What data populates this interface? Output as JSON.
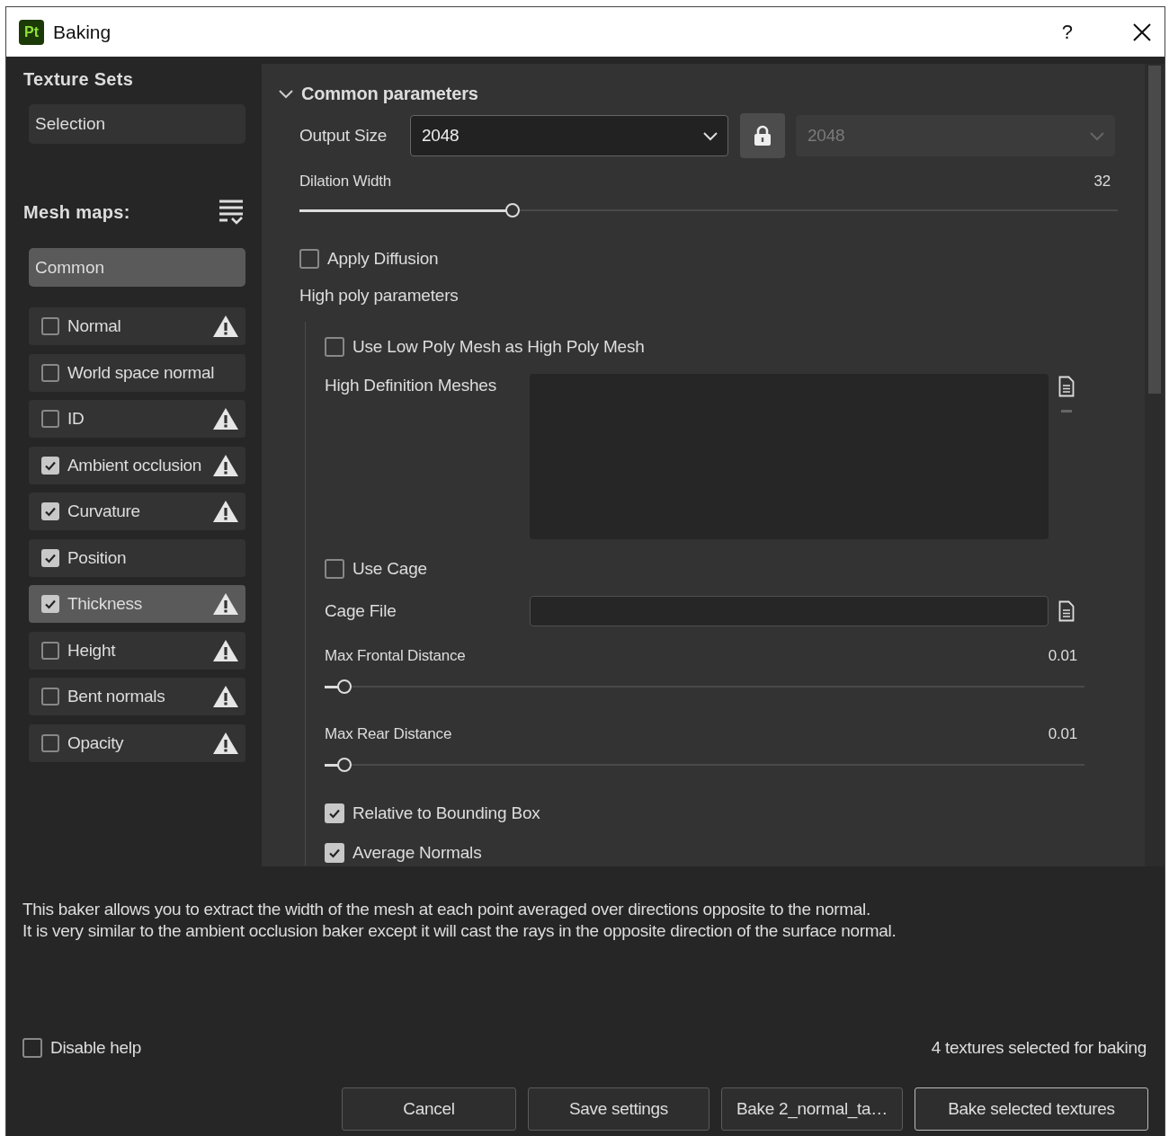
{
  "window": {
    "app_badge": "Pt",
    "title": "Baking",
    "help_button": "?"
  },
  "texture_sets": {
    "title": "Texture Sets",
    "items": [
      {
        "label": "Selection"
      }
    ]
  },
  "mesh_maps": {
    "title": "Mesh maps:",
    "common": {
      "label": "Common",
      "selected": true
    },
    "items": [
      {
        "label": "Normal",
        "checked": false,
        "selected": false,
        "warning": true
      },
      {
        "label": "World space normal",
        "checked": false,
        "selected": false,
        "warning": false
      },
      {
        "label": "ID",
        "checked": false,
        "selected": false,
        "warning": true
      },
      {
        "label": "Ambient occlusion",
        "checked": true,
        "selected": false,
        "warning": true
      },
      {
        "label": "Curvature",
        "checked": true,
        "selected": false,
        "warning": true
      },
      {
        "label": "Position",
        "checked": true,
        "selected": false,
        "warning": false
      },
      {
        "label": "Thickness",
        "checked": true,
        "selected": true,
        "warning": true
      },
      {
        "label": "Height",
        "checked": false,
        "selected": false,
        "warning": true
      },
      {
        "label": "Bent normals",
        "checked": false,
        "selected": false,
        "warning": true
      },
      {
        "label": "Opacity",
        "checked": false,
        "selected": false,
        "warning": true
      }
    ]
  },
  "common_parameters": {
    "title": "Common parameters",
    "expanded": true,
    "output_size": {
      "label": "Output Size",
      "value": "2048",
      "locked": true,
      "linked_value": "2048"
    },
    "dilation_width": {
      "label": "Dilation Width",
      "reading": "32",
      "level": 0.26
    },
    "apply_diffusion": {
      "label": "Apply Diffusion",
      "checked": false
    },
    "high_poly": {
      "title": "High poly parameters",
      "use_low_poly": {
        "label": "Use Low Poly Mesh as High Poly Mesh",
        "checked": false
      },
      "meshes": {
        "label": "High Definition Meshes"
      },
      "use_cage": {
        "label": "Use Cage",
        "checked": false
      },
      "cage_file": {
        "label": "Cage File"
      },
      "max_frontal": {
        "label": "Max Frontal Distance",
        "reading": "0.01",
        "level": 0.026
      },
      "max_rear": {
        "label": "Max Rear Distance",
        "reading": "0.01",
        "level": 0.026
      },
      "relative": {
        "label": "Relative to Bounding Box",
        "checked": true
      },
      "average_normals": {
        "label": "Average Normals",
        "checked": true
      }
    }
  },
  "help": {
    "lines": [
      "This baker allows you to extract the width of the mesh at each point averaged over directions opposite to the normal.",
      "It is very similar to the ambient occlusion baker except it will cast the rays in the opposite direction of the surface normal."
    ]
  },
  "disable_help": {
    "label": "Disable help",
    "checked": false
  },
  "status": "4 textures selected for baking",
  "buttons": [
    {
      "label": "Cancel",
      "primary": false
    },
    {
      "label": "Save settings",
      "primary": false
    },
    {
      "label": "Bake 2_normal_ta…",
      "primary": false
    },
    {
      "label": "Bake selected textures",
      "primary": true
    }
  ]
}
